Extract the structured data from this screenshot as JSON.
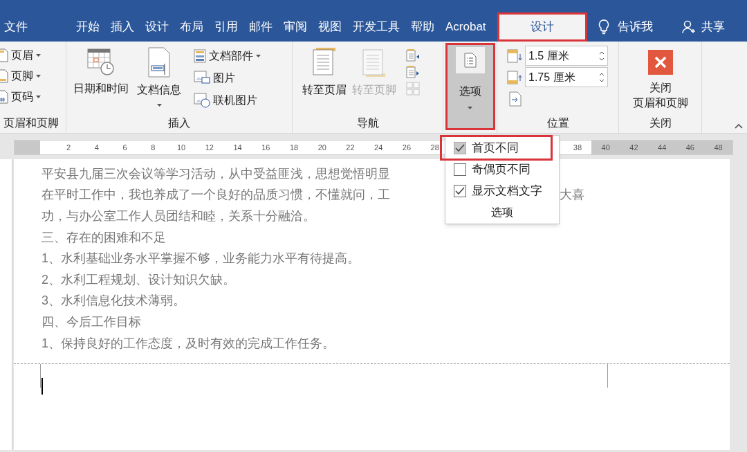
{
  "tabs": [
    {
      "label": "文件",
      "selected": false,
      "highlighted": false
    },
    {
      "label": "开始",
      "selected": false,
      "highlighted": false
    },
    {
      "label": "插入",
      "selected": false,
      "highlighted": false
    },
    {
      "label": "设计",
      "selected": false,
      "highlighted": false
    },
    {
      "label": "布局",
      "selected": false,
      "highlighted": false
    },
    {
      "label": "引用",
      "selected": false,
      "highlighted": false
    },
    {
      "label": "邮件",
      "selected": false,
      "highlighted": false
    },
    {
      "label": "审阅",
      "selected": false,
      "highlighted": false
    },
    {
      "label": "视图",
      "selected": false,
      "highlighted": false
    },
    {
      "label": "开发工具",
      "selected": false,
      "highlighted": false
    },
    {
      "label": "帮助",
      "selected": false,
      "highlighted": false
    },
    {
      "label": "Acrobat",
      "selected": false,
      "highlighted": false
    },
    {
      "label": "设计",
      "selected": true,
      "highlighted": true
    }
  ],
  "tell_me": {
    "label": "告诉我"
  },
  "share": {
    "label": "共享"
  },
  "header_footer_group": {
    "label": "页眉和页脚",
    "items": [
      {
        "label": "页眉"
      },
      {
        "label": "页脚"
      },
      {
        "label": "页码"
      }
    ]
  },
  "insert_group": {
    "label": "插入",
    "large_buttons": [
      {
        "label": "日期和时间",
        "has_menu": false
      },
      {
        "label": "文档信息",
        "has_menu": true
      }
    ],
    "small_buttons": [
      {
        "label": "文档部件",
        "has_menu": true
      },
      {
        "label": "图片",
        "has_menu": false
      },
      {
        "label": "联机图片",
        "has_menu": false
      }
    ]
  },
  "navigation_group": {
    "label": "导航",
    "buttons": [
      {
        "label": "转至页眉",
        "disabled": false
      },
      {
        "label": "转至页脚",
        "disabled": true
      }
    ]
  },
  "options_button": {
    "label": "选项",
    "pressed": true,
    "highlighted": true
  },
  "position_group": {
    "label": "位置",
    "fields": [
      {
        "value": "1.5 厘米"
      },
      {
        "value": "1.75 厘米"
      }
    ]
  },
  "close_group": {
    "label": "关闭",
    "button_lines": [
      "关闭",
      "页眉和页脚"
    ]
  },
  "ruler": {
    "left_labels": [
      "2",
      "4",
      "6",
      "8",
      "10",
      "12",
      "14",
      "16",
      "18",
      "20",
      "22",
      "24",
      "26",
      "28"
    ],
    "right_labels": [
      "38",
      "40",
      "42",
      "44",
      "46",
      "48"
    ]
  },
  "options_menu": {
    "items": [
      {
        "label": "首页不同",
        "checked": true,
        "highlighted": true
      },
      {
        "label": "奇偶页不同",
        "checked": false,
        "highlighted": false
      },
      {
        "label": "显示文档文字",
        "checked": true,
        "highlighted": false
      }
    ],
    "footer": "选项"
  },
  "document": {
    "lines": [
      {
        "text": "平安县九届三次会议等学习活动，从中受益匪浅，思想觉悟明显"
      },
      {
        "text": "在平时工作中，我也养成了一个良好的品质习惯，不懂就问，工",
        "right_text": "大喜"
      },
      {
        "text": "功，与办公室工作人员团结和睦，关系十分融洽。"
      },
      {
        "text": "三、存在的困难和不足"
      },
      {
        "text": "1、水利基础业务水平掌握不够，业务能力水平有待提高。"
      },
      {
        "text": "2、水利工程规划、设计知识欠缺。"
      },
      {
        "text": "3、水利信息化技术薄弱。"
      },
      {
        "text": "四、今后工作目标"
      },
      {
        "text": "1、保持良好的工作态度，及时有效的完成工作任务。"
      }
    ]
  }
}
